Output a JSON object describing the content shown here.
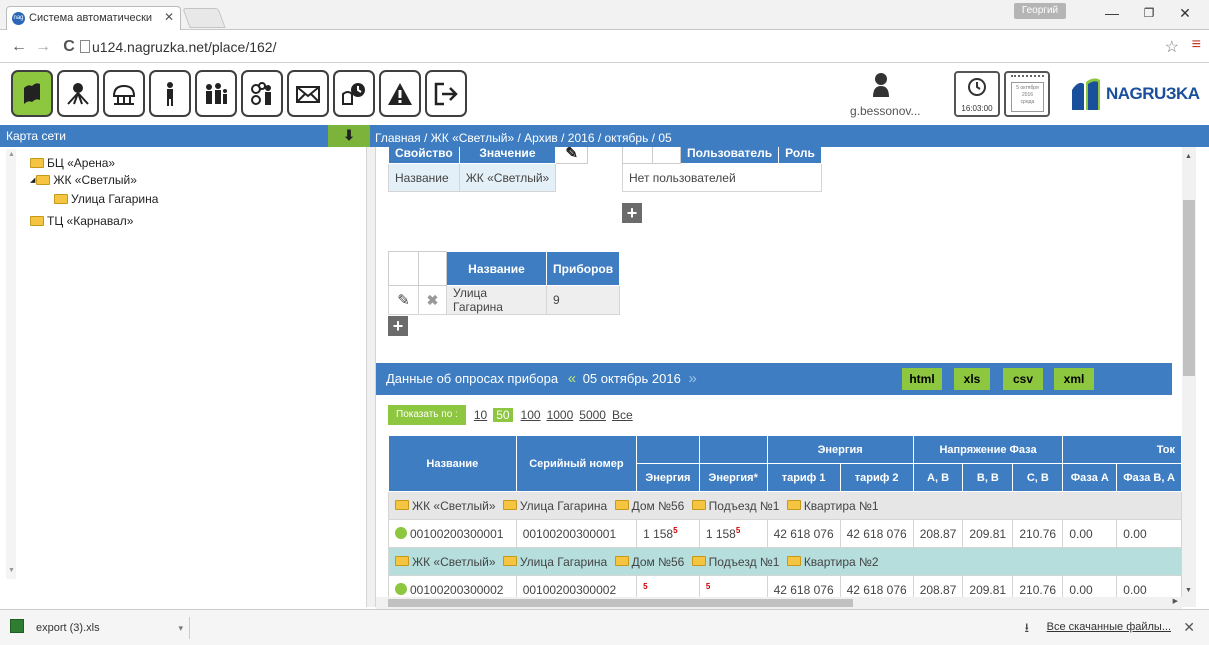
{
  "browser": {
    "tab_title": "Система автоматически",
    "tab_favicon": "nag",
    "user_chip": "Георгий",
    "url": "u124.nagruzka.net/place/162/"
  },
  "toolbar": {
    "username": "g.bessonov...",
    "clock_time": "16:03:00",
    "calendar_lines": [
      "5 октября",
      "2016",
      "среда"
    ],
    "logo_text": "NAGRUЗKA",
    "icons": [
      "map-icon",
      "network-icon",
      "tree-icon",
      "person-icon",
      "family-icon",
      "users-settings-icon",
      "mail-icon",
      "reports-clock-icon",
      "alert-icon",
      "logout-icon"
    ]
  },
  "sidebar": {
    "title": "Карта сети",
    "items": [
      "БЦ «Арена»",
      "ЖК «Светлый»",
      "Улица Гагарина",
      "ТЦ «Карнавал»"
    ]
  },
  "breadcrumb": "Главная  / ЖК «Светлый»  / Архив  / 2016  / октябрь  / 05",
  "props_table": {
    "headers": [
      "Свойство",
      "Значение"
    ],
    "row": [
      "Название",
      "ЖК «Светлый»"
    ]
  },
  "users_table": {
    "headers": [
      "Пользователь",
      "Роль"
    ],
    "empty_text": "Нет пользователей"
  },
  "streets_table": {
    "headers": [
      "Название",
      "Приборов"
    ],
    "row": [
      "Улица Гагарина",
      "9"
    ]
  },
  "data_panel": {
    "title": "Данные об опросах прибора",
    "date": "05 октябрь 2016",
    "formats": [
      "html",
      "xls",
      "csv",
      "xml"
    ],
    "show_label": "Показать по :",
    "page_sizes": [
      "10",
      "50",
      "100",
      "1000",
      "5000",
      "Все"
    ],
    "selected_page_size": "50"
  },
  "data_table": {
    "group_headers": {
      "energy": "Энергия",
      "voltage": "Напряжение Фаза",
      "current": "Ток"
    },
    "col_name": "Название",
    "col_serial": "Серийный номер",
    "sub_headers": [
      "Энергия",
      "Энергия*",
      "тариф 1",
      "тариф 2",
      "A, В",
      "B, В",
      "C, В",
      "Фаза A",
      "Фаза B, A"
    ],
    "group_rows": [
      [
        "ЖК «Светлый»",
        "Улица Гагарина",
        "Дом №56",
        "Подъезд №1",
        "Квартира №1"
      ],
      [
        "ЖК «Светлый»",
        "Улица Гагарина",
        "Дом №56",
        "Подъезд №1",
        "Квартира №2"
      ]
    ],
    "data_row": {
      "name": "00100200300001",
      "serial": "00100200300001",
      "energy": "1 158",
      "energy_sup": "5",
      "energy_star": "1 158",
      "energy_star_sup": "5",
      "t1": "42 618 076",
      "t2": "42 618 076",
      "va": "208.87",
      "vb": "209.81",
      "vc": "210.76",
      "ia": "0.00",
      "ib": "0.00"
    },
    "partial_row": {
      "name": "00100200300002",
      "serial": "00100200300002",
      "energy_sup": "5",
      "t1": "42 618 076",
      "t2": "42 618 076",
      "va": "208.87",
      "vb": "209.81",
      "vc": "210.76",
      "ia": "0.00",
      "ib": "0.00"
    }
  },
  "downloads": {
    "file": "export (3).xls",
    "show_all": "Все скачанные файлы..."
  }
}
